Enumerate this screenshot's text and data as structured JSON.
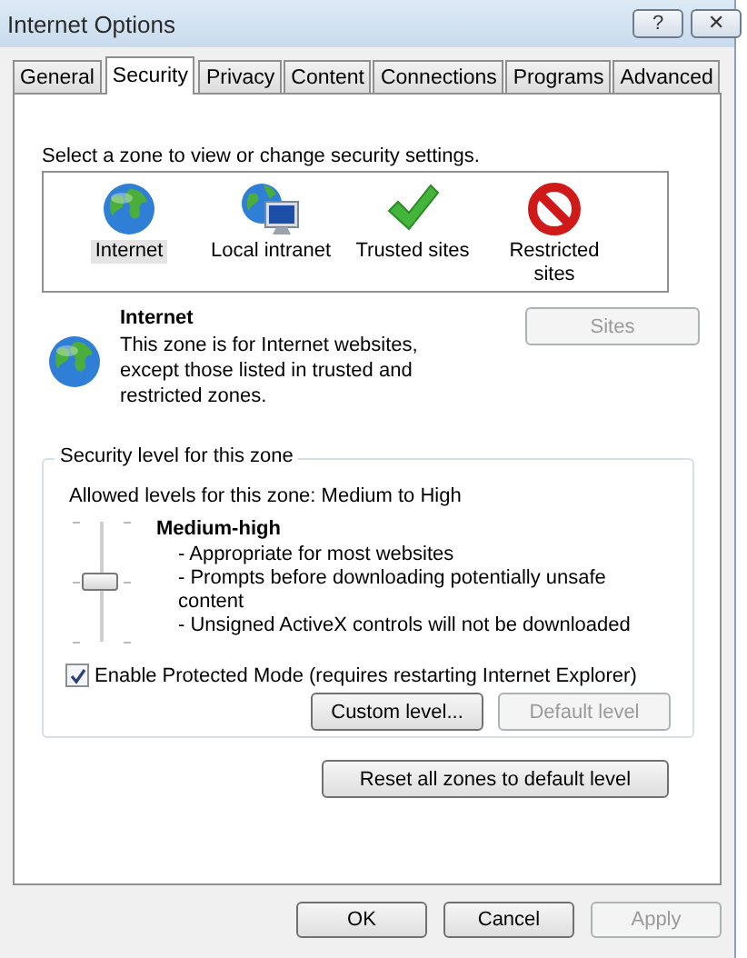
{
  "window": {
    "title": "Internet Options",
    "help": "?",
    "close": "✕"
  },
  "tabs": [
    {
      "label": "General",
      "selected": false
    },
    {
      "label": "Security",
      "selected": true
    },
    {
      "label": "Privacy",
      "selected": false
    },
    {
      "label": "Content",
      "selected": false
    },
    {
      "label": "Connections",
      "selected": false
    },
    {
      "label": "Programs",
      "selected": false
    },
    {
      "label": "Advanced",
      "selected": false
    }
  ],
  "zone_prompt": "Select a zone to view or change security settings.",
  "zones": [
    {
      "label": "Internet",
      "kind": "globe",
      "selected": true
    },
    {
      "label": "Local intranet",
      "kind": "intranet",
      "selected": false
    },
    {
      "label": "Trusted sites",
      "kind": "check",
      "selected": false
    },
    {
      "label": "Restricted sites",
      "kind": "restricted",
      "selected": false
    }
  ],
  "zone_info": {
    "title": "Internet",
    "description": "This zone is for Internet websites, except those listed in trusted and restricted zones.",
    "sites_button": {
      "label": "Sites",
      "disabled": true
    }
  },
  "security_level": {
    "legend": "Security level for this zone",
    "allowed": "Allowed levels for this zone: Medium to High",
    "level": 0.5,
    "name": "Medium-high",
    "bullets": [
      "- Appropriate for most websites",
      "- Prompts before downloading potentially unsafe content",
      "- Unsigned ActiveX controls will not be downloaded"
    ],
    "protected_mode": {
      "label": "Enable Protected Mode (requires restarting Internet Explorer)",
      "checked": true
    },
    "buttons": [
      {
        "label": "Custom level...",
        "disabled": false
      },
      {
        "label": "Default level",
        "disabled": true
      }
    ]
  },
  "reset_button": {
    "label": "Reset all zones to default level",
    "disabled": false
  },
  "footer_buttons": [
    {
      "label": "OK",
      "disabled": false
    },
    {
      "label": "Cancel",
      "disabled": false
    },
    {
      "label": "Apply",
      "disabled": true
    }
  ]
}
